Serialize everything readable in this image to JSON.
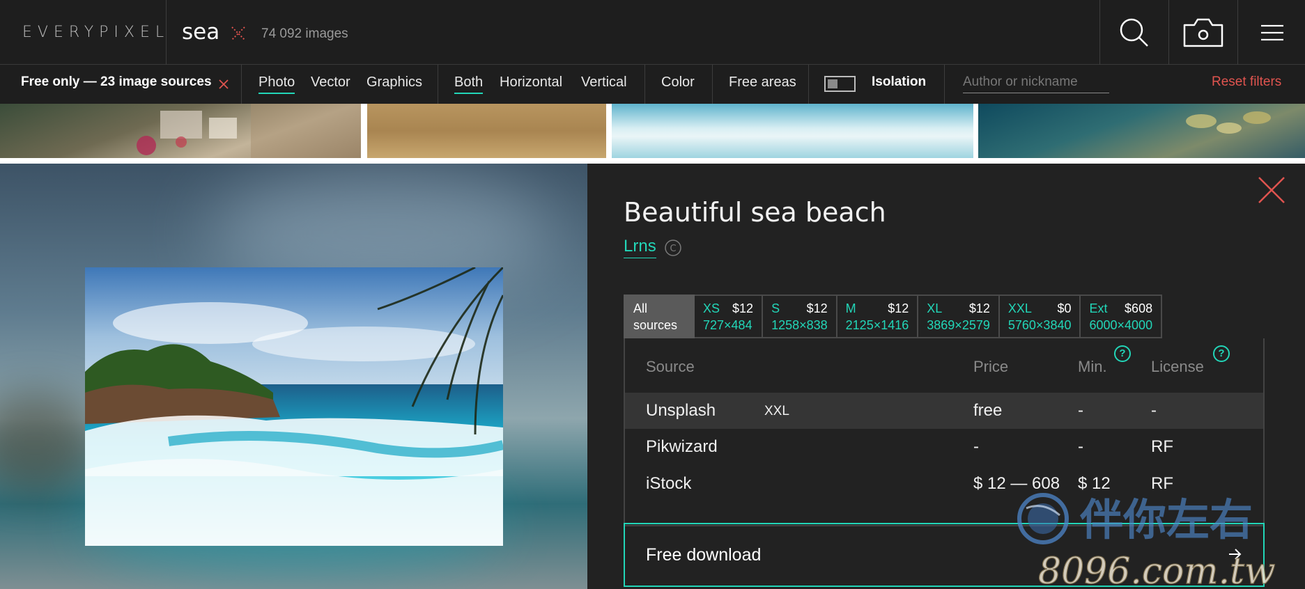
{
  "header": {
    "logo": "EVERYPIXEL",
    "query": "sea",
    "result_count": "74 092 images",
    "buttons": [
      "search-icon",
      "camera-icon",
      "menu-icon"
    ]
  },
  "filters": {
    "free_only": "Free only — 23 image sources",
    "types": [
      "Photo",
      "Vector",
      "Graphics"
    ],
    "active_type": "Photo",
    "orientations": [
      "Both",
      "Horizontal",
      "Vertical"
    ],
    "active_orientation": "Both",
    "color": "Color",
    "free_areas": "Free areas",
    "isolation": "Isolation",
    "author_placeholder": "Author or nickname",
    "reset": "Reset filters"
  },
  "detail": {
    "title": "Beautiful sea beach",
    "author": "Lrns",
    "sizes": [
      {
        "name": "All sources",
        "price": "",
        "dims": ""
      },
      {
        "name": "XS",
        "price": "$12",
        "dims": "727×484"
      },
      {
        "name": "S",
        "price": "$12",
        "dims": "1258×838"
      },
      {
        "name": "M",
        "price": "$12",
        "dims": "2125×1416"
      },
      {
        "name": "XL",
        "price": "$12",
        "dims": "3869×2579"
      },
      {
        "name": "XXL",
        "price": "$0",
        "dims": "5760×3840"
      },
      {
        "name": "Ext",
        "price": "$608",
        "dims": "6000×4000"
      }
    ],
    "table": {
      "headers": {
        "source": "Source",
        "price": "Price",
        "min": "Min.",
        "license": "License"
      },
      "rows": [
        {
          "source": "Unsplash",
          "size": "XXL",
          "price": "free",
          "min": "-",
          "license": "-"
        },
        {
          "source": "Pikwizard",
          "size": "",
          "price": "-",
          "min": "-",
          "license": "RF"
        },
        {
          "source": "iStock",
          "size": "",
          "price": "$ 12 — 608",
          "min": "$ 12",
          "license": "RF"
        }
      ]
    },
    "download": "Free download"
  },
  "watermark": {
    "line1": "伴你左右",
    "line2": "8096.com.tw"
  },
  "colors": {
    "accent": "#22d6b8",
    "danger": "#e0544f",
    "bg_dark": "#1e1e1e",
    "panel": "#222222"
  }
}
